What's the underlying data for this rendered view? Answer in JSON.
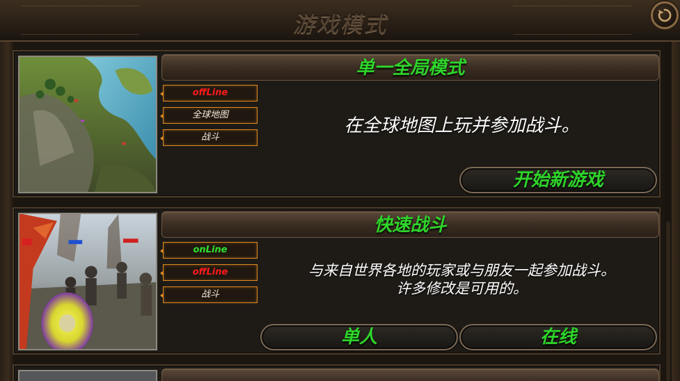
{
  "header": {
    "title": "游戏模式"
  },
  "modes": [
    {
      "title": "单一全局模式",
      "tags": [
        "offLine",
        "全球地图",
        "战斗"
      ],
      "description": "在全球地图上玩并参加战斗。",
      "buttons": [
        "开始新游戏"
      ]
    },
    {
      "title": "快速战斗",
      "tags": [
        "onLine",
        "offLine",
        "战斗"
      ],
      "description_lines": [
        "与来自世界各地的玩家或与朋友一起参加战斗。",
        "许多修改是可用的。"
      ],
      "buttons": [
        "单人",
        "在线"
      ]
    }
  ],
  "colors": {
    "title_green": "#2ed42a",
    "offline_red": "#ff1a1a",
    "online_green": "#2fe02c",
    "tag_border": "#e0891f"
  },
  "icons": {
    "back": "circular-arrow-back-icon"
  }
}
